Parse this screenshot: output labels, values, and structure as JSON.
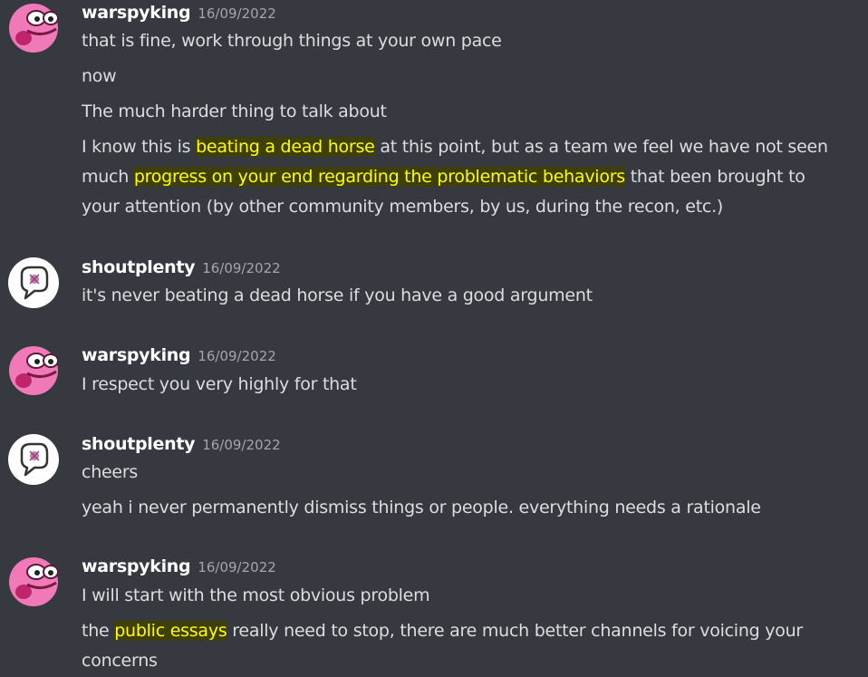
{
  "messages": [
    {
      "author": "warspyking",
      "timestamp": "16/09/2022",
      "lines": {
        "l1": "that is fine, work through things at your own pace",
        "l2": "now",
        "l3": "The much harder thing to talk about",
        "l4": {
          "a": "I know this is ",
          "hl1": "beating a dead horse",
          "b": " at this point, but as a team we feel we have not seen",
          "c": "much ",
          "hl2": "progress on your end regarding the problematic behaviors",
          "d": " that been brought to",
          "e": "your attention (by other community members, by us, during the recon, etc.)"
        }
      }
    },
    {
      "author": "shoutplenty",
      "timestamp": "16/09/2022",
      "lines": {
        "l1": "it's never beating a dead horse if you have a good argument"
      }
    },
    {
      "author": "warspyking",
      "timestamp": "16/09/2022",
      "lines": {
        "l1": "I respect you very highly for that"
      }
    },
    {
      "author": "shoutplenty",
      "timestamp": "16/09/2022",
      "lines": {
        "l1": "cheers",
        "l2": "yeah i never permanently dismiss things or people. everything needs a rationale"
      }
    },
    {
      "author": "warspyking",
      "timestamp": "16/09/2022",
      "lines": {
        "l1": "I will start with the most obvious problem",
        "l2": {
          "a": "the ",
          "hl": "public essays",
          "b": " really need to stop, there are much better channels for voicing your",
          "c": "concerns"
        }
      }
    }
  ],
  "icons": {
    "warspyking_avatar": "pink-frog-avatar-icon",
    "shoutplenty_avatar": "speech-bubble-avatar-icon"
  },
  "colors": {
    "background": "#36393f",
    "username": "#ffffff",
    "timestamp": "#a3a6aa",
    "text": "#dcddde",
    "highlight_bg": "#3f3f08",
    "highlight_fg": "#ffff00"
  }
}
